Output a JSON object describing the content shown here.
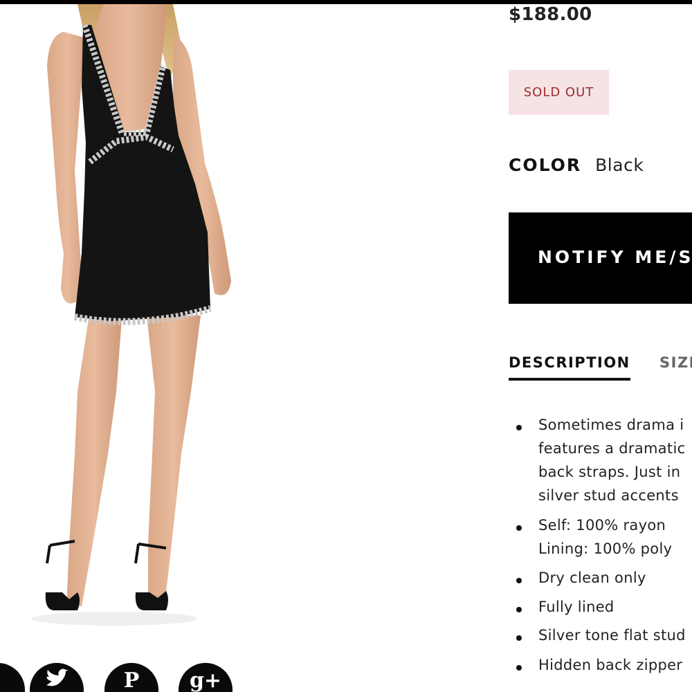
{
  "product": {
    "price": "$188.00",
    "status_badge": "SOLD OUT",
    "color_label": "COLOR",
    "color_value": "Black",
    "notify_button_label": "NOTIFY ME/S"
  },
  "tabs": [
    {
      "label": "DESCRIPTION",
      "active": true
    },
    {
      "label": "SIZI",
      "active": false
    }
  ],
  "description": {
    "bullets": [
      {
        "lines": [
          "Sometimes drama i",
          "features a dramatic",
          "back straps. Just in",
          "silver stud accents"
        ]
      },
      {
        "lines": [
          "Self: 100% rayon",
          "Lining: 100% poly"
        ]
      },
      {
        "lines": [
          "Dry clean only"
        ]
      },
      {
        "lines": [
          "Fully lined"
        ]
      },
      {
        "lines": [
          "Silver tone flat stud"
        ]
      },
      {
        "lines": [
          "Hidden back zipper"
        ]
      }
    ]
  },
  "share": {
    "icons": [
      "facebook-icon",
      "twitter-icon",
      "pinterest-icon",
      "google-plus-icon"
    ],
    "googleplus_glyph": "g+",
    "pinterest_glyph": "P"
  },
  "colors": {
    "sold_out_bg": "#f6e3e4",
    "sold_out_text": "#9e2a2f",
    "button_bg": "#000000",
    "button_text": "#ffffff"
  }
}
